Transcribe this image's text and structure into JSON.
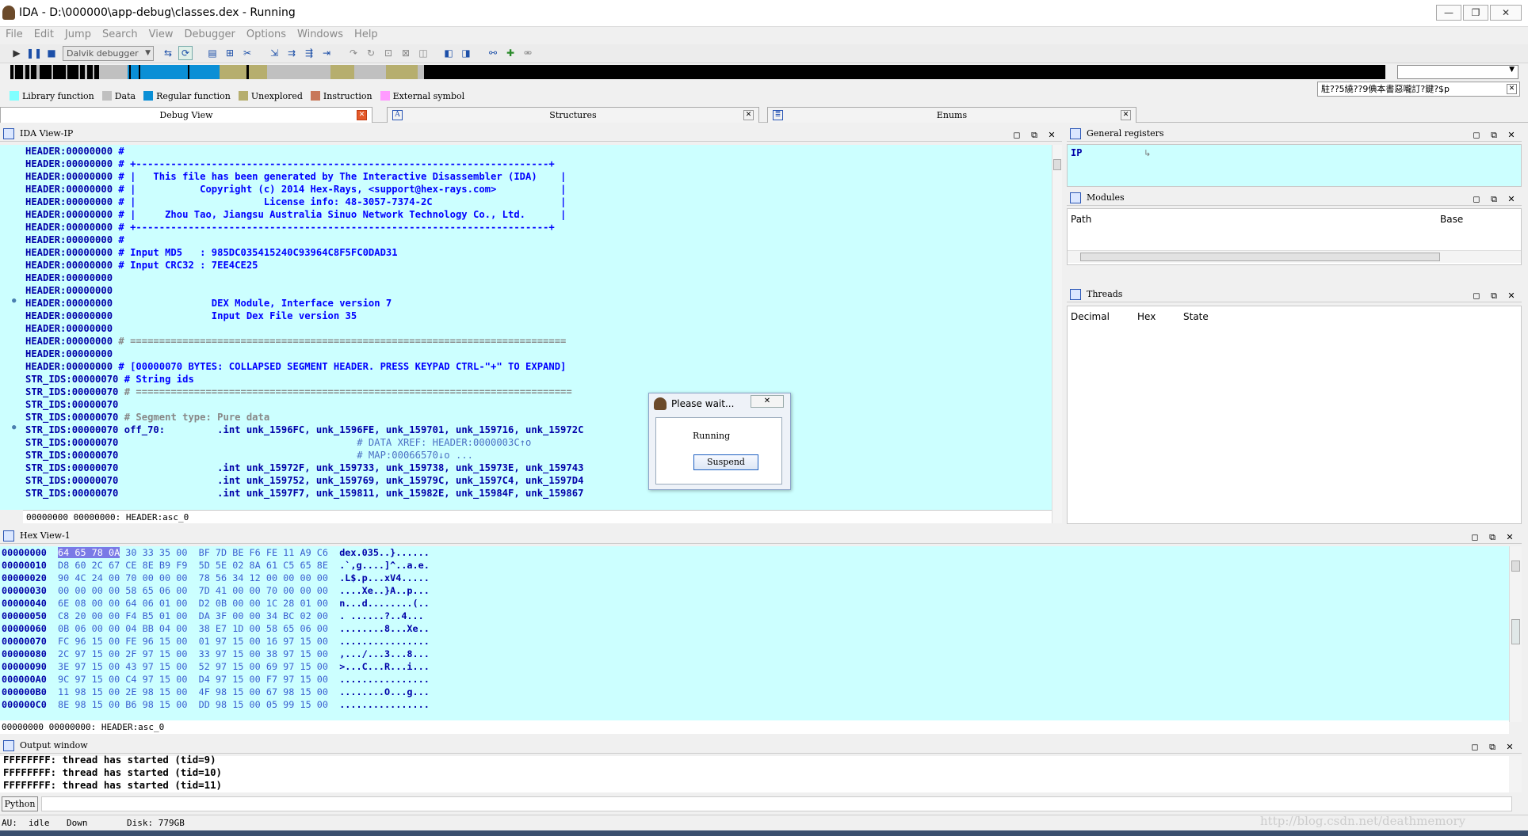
{
  "window": {
    "title": "IDA - D:\\000000\\app-debug\\classes.dex - Running",
    "controls": {
      "minimize": "—",
      "restore": "❐",
      "close": "✕"
    }
  },
  "menu": [
    "File",
    "Edit",
    "Jump",
    "Search",
    "View",
    "Debugger",
    "Options",
    "Windows",
    "Help"
  ],
  "toolbar": {
    "debugger_select": "Dalvik debugger"
  },
  "legend": [
    {
      "label": "Library function",
      "color": "#7fffff"
    },
    {
      "label": "Data",
      "color": "#c0c0c0"
    },
    {
      "label": "Regular function",
      "color": "#0a8fd6"
    },
    {
      "label": "Unexplored",
      "color": "#b6ae6e"
    },
    {
      "label": "Instruction",
      "color": "#c8785a"
    },
    {
      "label": "External symbol",
      "color": "#ff9bff"
    }
  ],
  "notify_text": "駐??5繞??9倎本書惡嚨訂?鍵?$p",
  "tabs": {
    "debug_view": "Debug View",
    "structures": "Structures",
    "enums": "Enums"
  },
  "ida_view": {
    "title": "IDA View-IP",
    "status": "00000000 00000000: HEADER:asc_0",
    "lines": [
      {
        "addr": "HEADER:00000000",
        "text": " #",
        "cls": "cmt"
      },
      {
        "addr": "HEADER:00000000",
        "text": " # +-----------------------------------------------------------------------+",
        "cls": "cmt"
      },
      {
        "addr": "HEADER:00000000",
        "text": " # |   This file has been generated by The Interactive Disassembler (IDA)    |",
        "cls": "cmt"
      },
      {
        "addr": "HEADER:00000000",
        "text": " # |           Copyright (c) 2014 Hex-Rays, <support@hex-rays.com>           |",
        "cls": "cmt"
      },
      {
        "addr": "HEADER:00000000",
        "text": " # |                      License info: 48-3057-7374-2C                      |",
        "cls": "cmt"
      },
      {
        "addr": "HEADER:00000000",
        "text": " # |     Zhou Tao, Jiangsu Australia Sinuo Network Technology Co., Ltd.      |",
        "cls": "cmt"
      },
      {
        "addr": "HEADER:00000000",
        "text": " # +-----------------------------------------------------------------------+",
        "cls": "cmt"
      },
      {
        "addr": "HEADER:00000000",
        "text": " #",
        "cls": "cmt"
      },
      {
        "addr": "HEADER:00000000",
        "text": " # Input MD5   : 985DC035415240C93964C8F5FC0DAD31",
        "cls": "cmt"
      },
      {
        "addr": "HEADER:00000000",
        "text": " # Input CRC32 : 7EE4CE25",
        "cls": "cmt"
      },
      {
        "addr": "HEADER:00000000",
        "text": "",
        "cls": "cmt"
      },
      {
        "addr": "HEADER:00000000",
        "text": "",
        "cls": "cmt"
      },
      {
        "addr": "HEADER:00000000",
        "text": "                 DEX Module, Interface version 7",
        "cls": "cmt"
      },
      {
        "addr": "HEADER:00000000",
        "text": "                 Input Dex File version 35",
        "cls": "cmt"
      },
      {
        "addr": "HEADER:00000000",
        "text": "",
        "cls": "cmt"
      },
      {
        "addr": "HEADER:00000000",
        "text": " # ===========================================================================",
        "cls": "gcmt"
      },
      {
        "addr": "HEADER:00000000",
        "text": "",
        "cls": "cmt"
      },
      {
        "addr": "HEADER:00000000",
        "text": " # [00000070 BYTES: COLLAPSED SEGMENT HEADER. PRESS KEYPAD CTRL-\"+\" TO EXPAND]",
        "cls": "cmt"
      },
      {
        "addr": "STR_IDS:00000070",
        "text": " # String ids",
        "cls": "cmt"
      },
      {
        "addr": "STR_IDS:00000070",
        "text": " # ===========================================================================",
        "cls": "gcmt"
      },
      {
        "addr": "STR_IDS:00000070",
        "text": "",
        "cls": "cmt"
      },
      {
        "addr": "STR_IDS:00000070",
        "text": " # Segment type: Pure data",
        "cls": "gcmt"
      },
      {
        "addr": "STR_IDS:00000070",
        "text": " off_70:         .int unk_1596FC, unk_1596FE, unk_159701, unk_159716, unk_15972C",
        "cls": "code"
      },
      {
        "addr": "STR_IDS:00000070",
        "text": "                                         # DATA XREF: HEADER:0000003C↑o",
        "cls": "xref"
      },
      {
        "addr": "STR_IDS:00000070",
        "text": "                                         # MAP:00066570↓o ...",
        "cls": "xref"
      },
      {
        "addr": "STR_IDS:00000070",
        "text": "                 .int unk_15972F, unk_159733, unk_159738, unk_15973E, unk_159743",
        "cls": "code"
      },
      {
        "addr": "STR_IDS:00000070",
        "text": "                 .int unk_159752, unk_159769, unk_15979C, unk_1597C4, unk_1597D4",
        "cls": "code"
      },
      {
        "addr": "STR_IDS:00000070",
        "text": "                 .int unk_1597F7, unk_159811, unk_15982E, unk_15984F, unk_159867",
        "cls": "code"
      }
    ]
  },
  "dialog": {
    "title": "Please wait...",
    "message": "Running",
    "button": "Suspend",
    "close": "✕"
  },
  "registers": {
    "title": "General registers",
    "ip_label": "IP"
  },
  "modules": {
    "title": "Modules",
    "columns": [
      "Path",
      "Base"
    ]
  },
  "threads": {
    "title": "Threads",
    "columns": [
      "Decimal",
      "Hex",
      "State"
    ]
  },
  "hex_view": {
    "title": "Hex View-1",
    "status": "00000000 00000000: HEADER:asc_0",
    "rows": [
      {
        "addr": "00000000",
        "b1": "64 65 78 0A",
        "b2": "30 33 35 00  BF 7D BE F6 FE 11 A9 C6",
        "ascii": "dex.035..}......"
      },
      {
        "addr": "00000010",
        "b1": "D8 60 2C 67",
        "b2": "CE 8E B9 F9  5D 5E 02 8A 61 C5 65 8E",
        "ascii": ".`,g....]^..a.e."
      },
      {
        "addr": "00000020",
        "b1": "90 4C 24 00",
        "b2": "70 00 00 00  78 56 34 12 00 00 00 00",
        "ascii": ".L$.p...xV4....."
      },
      {
        "addr": "00000030",
        "b1": "00 00 00 00",
        "b2": "58 65 06 00  7D 41 00 00 70 00 00 00",
        "ascii": "....Xe..}A..p..."
      },
      {
        "addr": "00000040",
        "b1": "6E 08 00 00",
        "b2": "64 06 01 00  D2 0B 00 00 1C 28 01 00",
        "ascii": "n...d........(.."
      },
      {
        "addr": "00000050",
        "b1": "C8 20 00 00",
        "b2": "F4 B5 01 00  DA 3F 00 00 34 BC 02 00",
        "ascii": ". ......?..4..."
      },
      {
        "addr": "00000060",
        "b1": "0B 06 00 00",
        "b2": "04 BB 04 00  38 E7 1D 00 58 65 06 00",
        "ascii": "........8...Xe.."
      },
      {
        "addr": "00000070",
        "b1": "FC 96 15 00",
        "b2": "FE 96 15 00  01 97 15 00 16 97 15 00",
        "ascii": "................"
      },
      {
        "addr": "00000080",
        "b1": "2C 97 15 00",
        "b2": "2F 97 15 00  33 97 15 00 38 97 15 00",
        "ascii": ",.../...3...8..."
      },
      {
        "addr": "00000090",
        "b1": "3E 97 15 00",
        "b2": "43 97 15 00  52 97 15 00 69 97 15 00",
        "ascii": ">...C...R...i..."
      },
      {
        "addr": "000000A0",
        "b1": "9C 97 15 00",
        "b2": "C4 97 15 00  D4 97 15 00 F7 97 15 00",
        "ascii": "................"
      },
      {
        "addr": "000000B0",
        "b1": "11 98 15 00",
        "b2": "2E 98 15 00  4F 98 15 00 67 98 15 00",
        "ascii": "........O...g..."
      },
      {
        "addr": "000000C0",
        "b1": "8E 98 15 00",
        "b2": "B6 98 15 00  DD 98 15 00 05 99 15 00",
        "ascii": "................"
      }
    ]
  },
  "output": {
    "title": "Output window",
    "lines": [
      "FFFFFFFF: thread has started (tid=9)",
      "FFFFFFFF: thread has started (tid=10)",
      "FFFFFFFF: thread has started (tid=11)"
    ]
  },
  "python_button": "Python",
  "status": {
    "au": "AU:",
    "state": "idle",
    "dir": "Down",
    "disk": "Disk: 779GB"
  },
  "watermark": "http://blog.csdn.net/deathmemory"
}
